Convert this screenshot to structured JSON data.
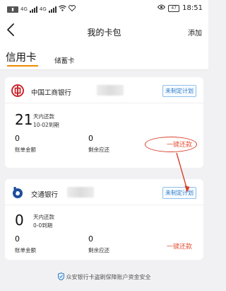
{
  "status_bar": {
    "signal_left": "4G",
    "signal_right": "4G",
    "battery": "47",
    "time": "18:51"
  },
  "nav": {
    "title": "我的卡包",
    "add_label": "添加"
  },
  "tabs": [
    {
      "label": "信用卡",
      "active": true
    },
    {
      "label": "储蓄卡",
      "active": false
    }
  ],
  "cards": [
    {
      "bank_name": "中国工商银行",
      "plan_badge": "未制定计划",
      "days_value": "21",
      "days_label": "天内还款",
      "due_label": "10-02到期",
      "bill_amount": "0",
      "bill_amount_label": "账单金额",
      "remaining": "0",
      "remaining_label": "剩余应还",
      "repay_label": "一键还款"
    },
    {
      "bank_name": "交通银行",
      "plan_badge": "未制定计划",
      "days_value": "0",
      "days_label": "天内还款",
      "due_label": "0-0到期",
      "bill_amount": "0",
      "bill_amount_label": "账单金额",
      "remaining": "0",
      "remaining_label": "剩余应还",
      "repay_label": "一键还款"
    }
  ],
  "footer": {
    "text": "众安银行卡盗刷保障账户资金安全"
  },
  "colors": {
    "accent": "#f08a00",
    "repay": "#e4543a",
    "badge": "#2b79c7",
    "annotation": "#d9402c"
  }
}
